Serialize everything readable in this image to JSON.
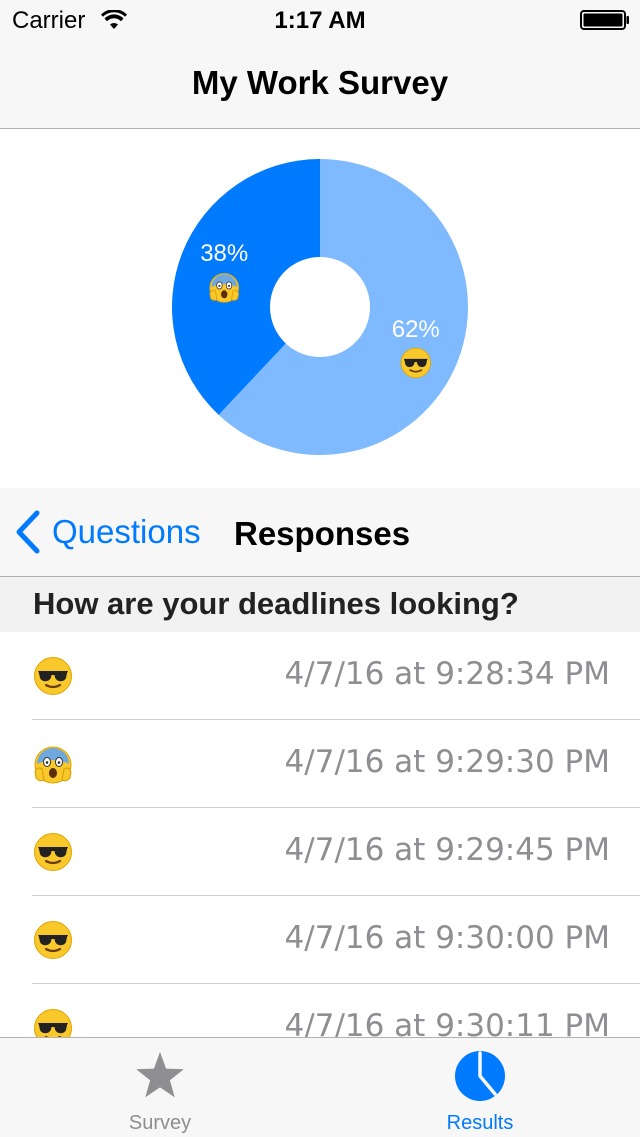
{
  "status_bar": {
    "carrier": "Carrier",
    "time": "1:17 AM"
  },
  "nav": {
    "title": "My Work Survey"
  },
  "chart_data": {
    "type": "pie",
    "variant": "donut",
    "slices": [
      {
        "label": "38%",
        "value": 38,
        "emoji": "scream",
        "color": "#007aff"
      },
      {
        "label": "62%",
        "value": 62,
        "emoji": "sunglasses",
        "color": "#7fbaff"
      }
    ]
  },
  "sub_nav": {
    "back_label": "Questions",
    "title": "Responses"
  },
  "section": {
    "title": "How are your deadlines looking?"
  },
  "responses": [
    {
      "emoji": "sunglasses",
      "time": "4/7/16 at 9:28:34 PM"
    },
    {
      "emoji": "scream",
      "time": "4/7/16 at 9:29:30 PM"
    },
    {
      "emoji": "sunglasses",
      "time": "4/7/16 at 9:29:45 PM"
    },
    {
      "emoji": "sunglasses",
      "time": "4/7/16 at 9:30:00 PM"
    },
    {
      "emoji": "sunglasses",
      "time": "4/7/16 at 9:30:11 PM"
    }
  ],
  "tabs": [
    {
      "label": "Survey",
      "icon": "star-icon",
      "active": false,
      "color": "#8e8e93"
    },
    {
      "label": "Results",
      "icon": "pie-chart-icon",
      "active": true,
      "color": "#007aff"
    }
  ],
  "colors": {
    "accent": "#007aff",
    "light_accent": "#7fbaff",
    "inactive": "#8e8e93"
  }
}
